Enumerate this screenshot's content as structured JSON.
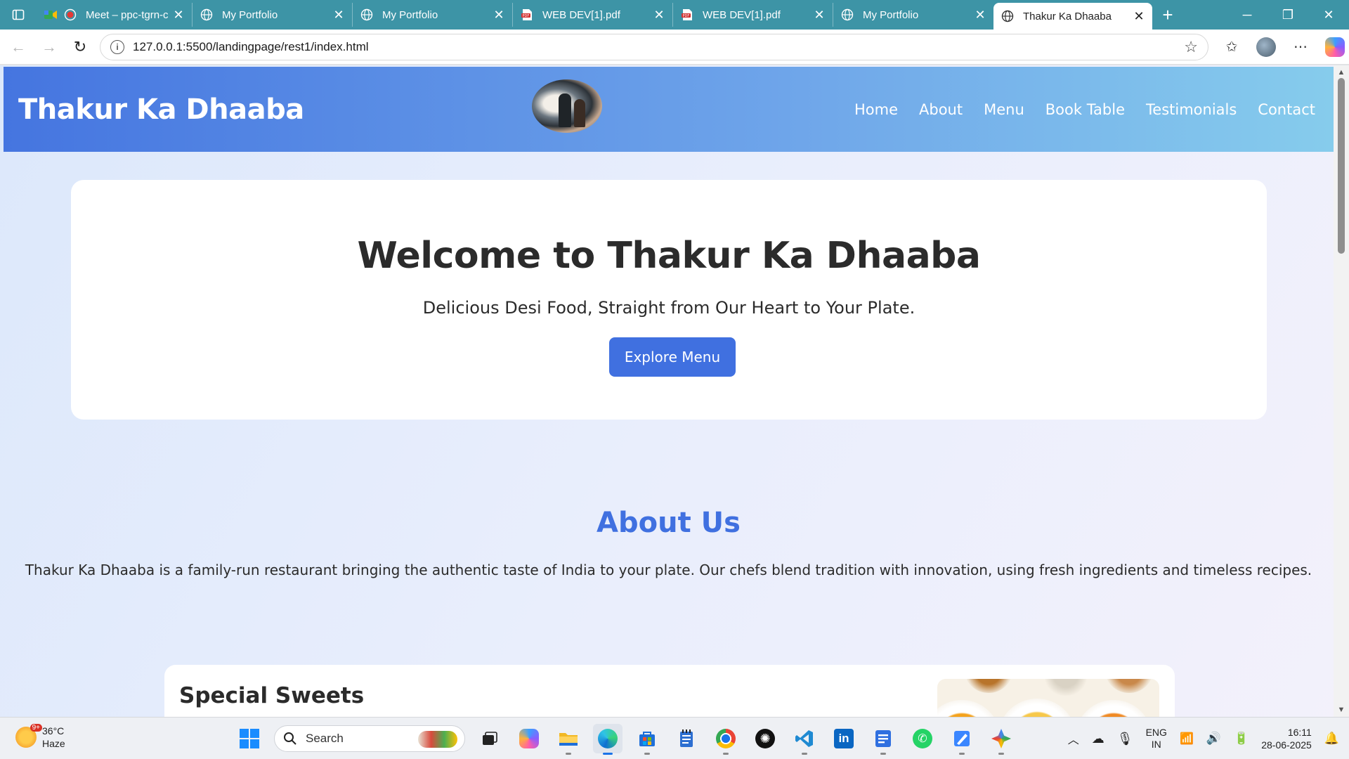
{
  "browser": {
    "tabs": [
      {
        "title": "Meet – ppc-tgrn-c",
        "icon": "meet-icon",
        "recording": true
      },
      {
        "title": "My Portfolio",
        "icon": "globe-icon"
      },
      {
        "title": "My Portfolio",
        "icon": "globe-icon"
      },
      {
        "title": "WEB DEV[1].pdf",
        "icon": "pdf-icon"
      },
      {
        "title": "WEB DEV[1].pdf",
        "icon": "pdf-icon"
      },
      {
        "title": "My Portfolio",
        "icon": "globe-icon"
      },
      {
        "title": "Thakur Ka Dhaaba",
        "icon": "globe-icon",
        "active": true
      }
    ],
    "url": "127.0.0.1:5500/landingpage/rest1/index.html"
  },
  "site": {
    "brand": "Thakur Ka Dhaaba",
    "nav": [
      "Home",
      "About",
      "Menu",
      "Book Table",
      "Testimonials",
      "Contact"
    ],
    "hero": {
      "title": "Welcome to Thakur Ka Dhaaba",
      "subtitle": "Delicious Desi Food, Straight from Our Heart to Your Plate.",
      "cta": "Explore Menu"
    },
    "about": {
      "title": "About Us",
      "text": "Thakur Ka Dhaaba is a family-run restaurant bringing the authentic taste of India to your plate. Our chefs blend tradition with innovation, using fresh ingredients and timeless recipes."
    },
    "special": {
      "title": "Special Sweets"
    },
    "colors": {
      "accent": "#4070e0",
      "header_start": "#4575e0",
      "header_end": "#86ccec"
    }
  },
  "taskbar": {
    "weather": {
      "temp": "36°C",
      "condition": "Haze",
      "badge": "9+"
    },
    "search_placeholder": "Search",
    "lang": {
      "line1": "ENG",
      "line2": "IN"
    },
    "time": "16:11",
    "date": "28-06-2025"
  }
}
